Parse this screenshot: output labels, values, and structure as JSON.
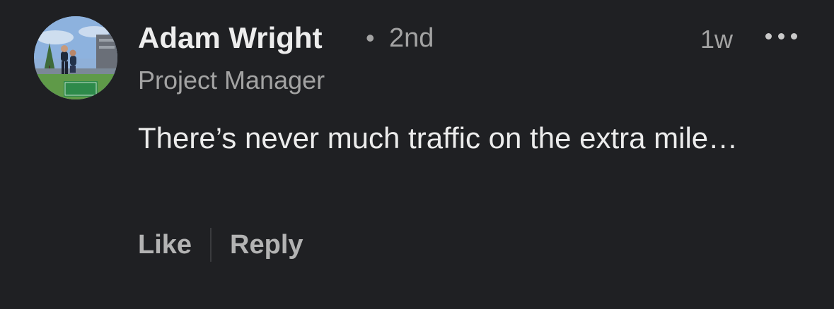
{
  "comment": {
    "author": {
      "name": "Adam Wright",
      "separator": "•",
      "connection_degree": "2nd",
      "headline": "Project Manager",
      "avatar_icon": "profile-photo"
    },
    "timestamp": "1w",
    "more_icon": "more-horizontal-icon",
    "text": "There’s never much traffic on the extra mile…",
    "actions": {
      "like_label": "Like",
      "reply_label": "Reply"
    }
  },
  "colors": {
    "background": "#1f2023",
    "primary_text": "#ececec",
    "secondary_text": "#a3a3a3",
    "action_text": "#b3b3b3"
  }
}
